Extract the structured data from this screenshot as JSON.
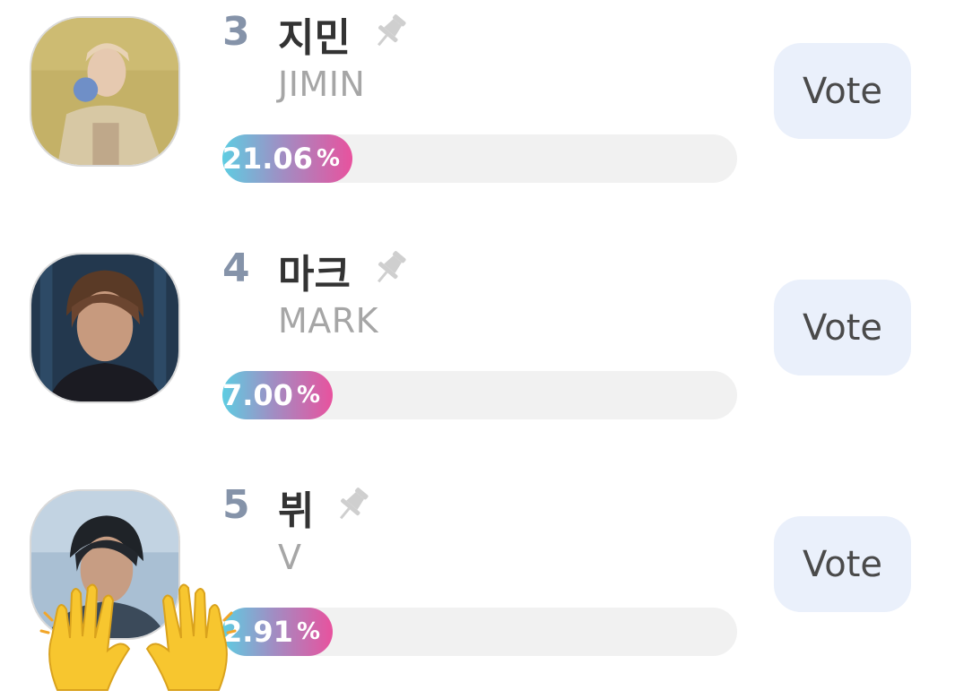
{
  "vote_label": "Vote",
  "percent_sign": "%",
  "items": [
    {
      "rank": "3",
      "name": "지민",
      "romanized": "JIMIN",
      "percent_text": "21.06",
      "share": 0.2106
    },
    {
      "rank": "4",
      "name": "마크",
      "romanized": "MARK",
      "percent_text": "7.00",
      "share": 0.07
    },
    {
      "rank": "5",
      "name": "뷔",
      "romanized": "V",
      "percent_text": "2.91",
      "share": 0.0291
    }
  ],
  "icons": {
    "pin": "pin-icon",
    "hands": "raised-hands-emoji"
  },
  "colors": {
    "rank": "#8593a9",
    "bar_start": "#5dcde2",
    "bar_end": "#e8529e",
    "vote_bg": "#eaf0fb"
  }
}
